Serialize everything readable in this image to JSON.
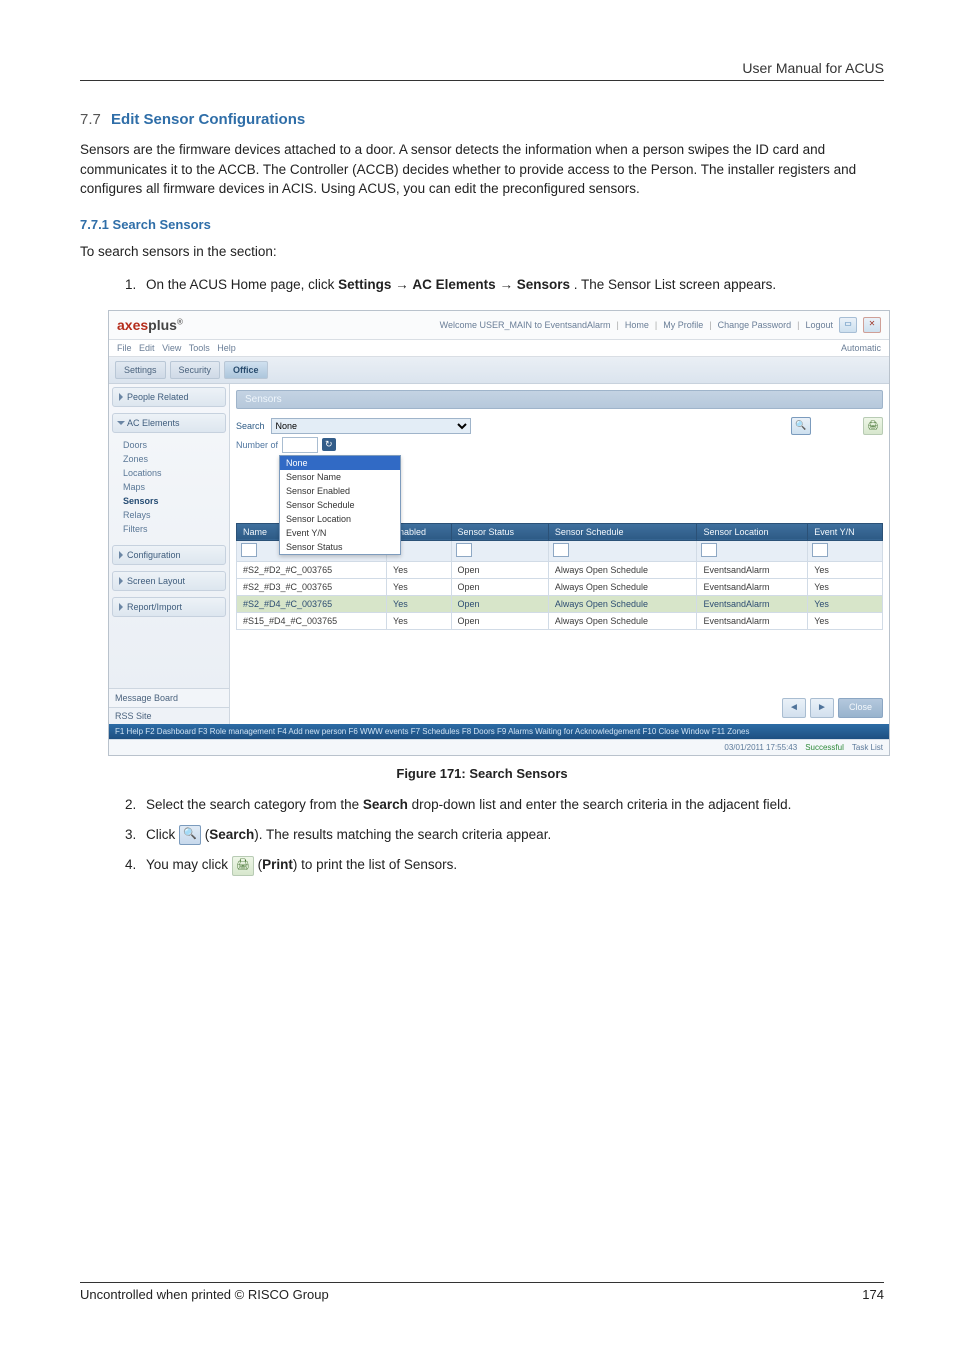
{
  "doc": {
    "header": "User Manual for ACUS",
    "section_num": "7.7",
    "section_title": "Edit Sensor Configurations",
    "para1": "Sensors are the firmware devices attached to a door. A sensor detects the information when a person swipes the ID card and communicates it to the ACCB. The Controller (ACCB) decides whether to provide access to the Person. The installer registers and configures all firmware devices in ACIS. Using ACUS, you can edit the preconfigured sensors.",
    "subsection": "7.7.1 Search Sensors",
    "para2": "To search sensors in the section:",
    "step1_a": "On the ACUS Home page, click ",
    "step1_b": "Settings",
    "step1_c": "AC Elements",
    "step1_d": "Sensors",
    "step1_e": ". The Sensor List screen appears.",
    "figcap": "Figure 171: Search Sensors",
    "step2_a": "Select the search category from the ",
    "step2_b": "Search",
    "step2_c": " drop-down list and enter the search criteria in the adjacent field.",
    "step3_a": "Click ",
    "step3_b": " (",
    "step3_c": "Search",
    "step3_d": "). The results matching the search criteria appear.",
    "step4_a": "You may click ",
    "step4_b": " (",
    "step4_c": "Print",
    "step4_d": ") to print the list of Sensors.",
    "footer_left": "Uncontrolled when printed © RISCO Group",
    "footer_right": "174"
  },
  "app": {
    "logo_a": "axes",
    "logo_b": "plus",
    "welcome": "Welcome USER_MAIN to EventsandAlarm",
    "top_links": [
      "Home",
      "My Profile",
      "Change Password",
      "Logout"
    ],
    "menus": [
      "File",
      "Edit",
      "View",
      "Tools",
      "Help"
    ],
    "role": "Automatic",
    "ribbon": [
      "Settings",
      "Security",
      "Office"
    ],
    "acc": {
      "people": "People Related",
      "ac": "AC Elements",
      "ac_items": [
        "Doors",
        "Zones",
        "Locations",
        "Maps",
        "Sensors",
        "Relays",
        "Filters"
      ],
      "config": "Configuration",
      "screen": "Screen Layout",
      "report": "Report/Import"
    },
    "msgboard": "Message Board",
    "rss": "RSS Site",
    "pane_title": "Sensors",
    "search_label": "Search",
    "search_value": "None",
    "dropdown": [
      "None",
      "Sensor Name",
      "Sensor Enabled",
      "Sensor Schedule",
      "Sensor Location",
      "Event Y/N",
      "Sensor Status"
    ],
    "number_label": "Number of",
    "grid_headers": [
      "Name",
      "Enabled",
      "Sensor Status",
      "Sensor Schedule",
      "Sensor Location",
      "Event Y/N"
    ],
    "grid_rows": [
      {
        "name": "#S2_#D2_#C_003765",
        "enabled": "Yes",
        "status": "Open",
        "schedule": "Always Open Schedule",
        "location": "EventsandAlarm",
        "event": "Yes",
        "sel": false
      },
      {
        "name": "#S2_#D3_#C_003765",
        "enabled": "Yes",
        "status": "Open",
        "schedule": "Always Open Schedule",
        "location": "EventsandAlarm",
        "event": "Yes",
        "sel": false
      },
      {
        "name": "#S2_#D4_#C_003765",
        "enabled": "Yes",
        "status": "Open",
        "schedule": "Always Open Schedule",
        "location": "EventsandAlarm",
        "event": "Yes",
        "sel": true
      },
      {
        "name": "#S15_#D4_#C_003765",
        "enabled": "Yes",
        "status": "Open",
        "schedule": "Always Open Schedule",
        "location": "EventsandAlarm",
        "event": "Yes",
        "sel": false
      }
    ],
    "close_btn": "Close",
    "fkeys": "F1 Help   F2 Dashboard   F3 Role management   F4 Add new person   F6 WWW events   F7 Schedules   F8 Doors   F9 Alarms Waiting for Acknowledgement   F10 Close Window   F11 Zones",
    "status_time": "03/01/2011 17:55:43",
    "status_msg": "Successful",
    "status_task": "Task List"
  }
}
